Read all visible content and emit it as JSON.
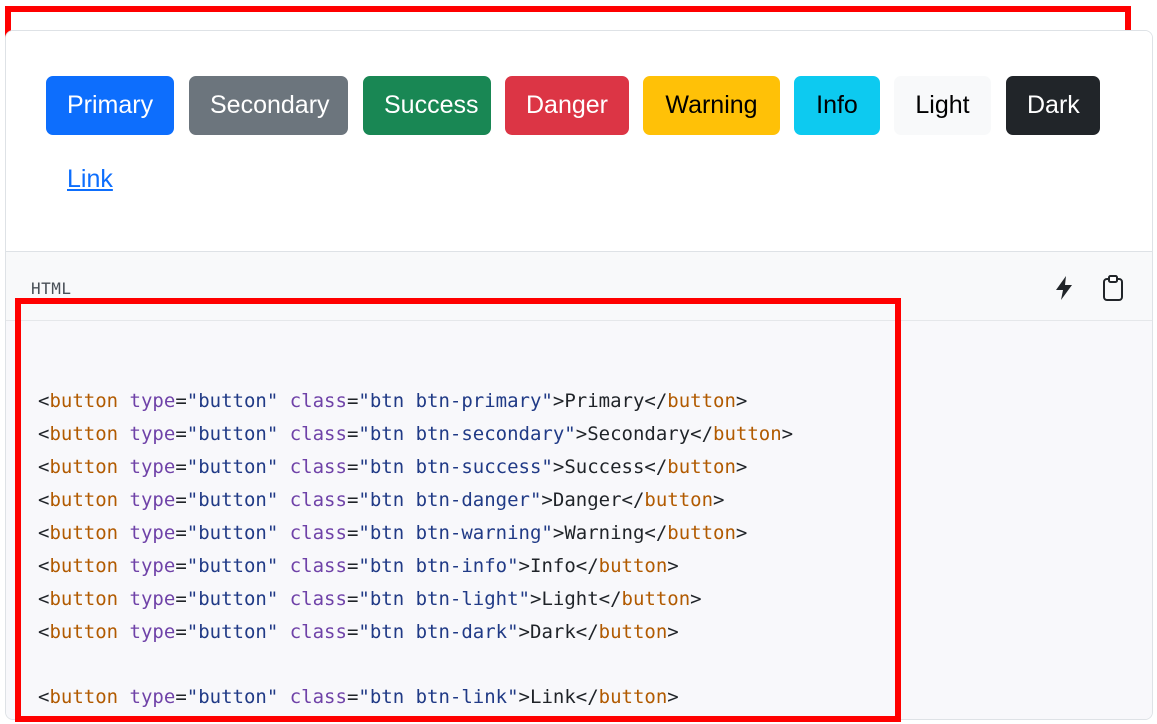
{
  "example": {
    "buttons": [
      {
        "label": "Primary",
        "bg": "#0d6efd",
        "fg": "#ffffff"
      },
      {
        "label": "Secondary",
        "bg": "#6c757d",
        "fg": "#ffffff"
      },
      {
        "label": "Success",
        "bg": "#198754",
        "fg": "#ffffff"
      },
      {
        "label": "Danger",
        "bg": "#dc3545",
        "fg": "#ffffff"
      },
      {
        "label": "Warning",
        "bg": "#ffc107",
        "fg": "#000000"
      },
      {
        "label": "Info",
        "bg": "#0dcaf0",
        "fg": "#000000"
      },
      {
        "label": "Light",
        "bg": "#f8f9fa",
        "fg": "#000000"
      },
      {
        "label": "Dark",
        "bg": "#212529",
        "fg": "#ffffff"
      }
    ],
    "link": {
      "label": "Link",
      "color": "#0d6efd"
    }
  },
  "code_toolbar": {
    "language": "HTML",
    "icons": [
      "lightning-icon",
      "clipboard-icon"
    ]
  },
  "code": {
    "lines": [
      {
        "tag": "button",
        "attr1": "type",
        "val1": "\"button\"",
        "attr2": "class",
        "val2": "\"btn btn-primary\"",
        "text": "Primary"
      },
      {
        "tag": "button",
        "attr1": "type",
        "val1": "\"button\"",
        "attr2": "class",
        "val2": "\"btn btn-secondary\"",
        "text": "Secondary"
      },
      {
        "tag": "button",
        "attr1": "type",
        "val1": "\"button\"",
        "attr2": "class",
        "val2": "\"btn btn-success\"",
        "text": "Success"
      },
      {
        "tag": "button",
        "attr1": "type",
        "val1": "\"button\"",
        "attr2": "class",
        "val2": "\"btn btn-danger\"",
        "text": "Danger"
      },
      {
        "tag": "button",
        "attr1": "type",
        "val1": "\"button\"",
        "attr2": "class",
        "val2": "\"btn btn-warning\"",
        "text": "Warning"
      },
      {
        "tag": "button",
        "attr1": "type",
        "val1": "\"button\"",
        "attr2": "class",
        "val2": "\"btn btn-info\"",
        "text": "Info"
      },
      {
        "tag": "button",
        "attr1": "type",
        "val1": "\"button\"",
        "attr2": "class",
        "val2": "\"btn btn-light\"",
        "text": "Light"
      },
      {
        "tag": "button",
        "attr1": "type",
        "val1": "\"button\"",
        "attr2": "class",
        "val2": "\"btn btn-dark\"",
        "text": "Dark"
      },
      {
        "tag": "button",
        "attr1": "type",
        "val1": "\"button\"",
        "attr2": "class",
        "val2": "\"btn btn-link\"",
        "text": "Link"
      }
    ]
  },
  "highlight_color": "#ff0000"
}
